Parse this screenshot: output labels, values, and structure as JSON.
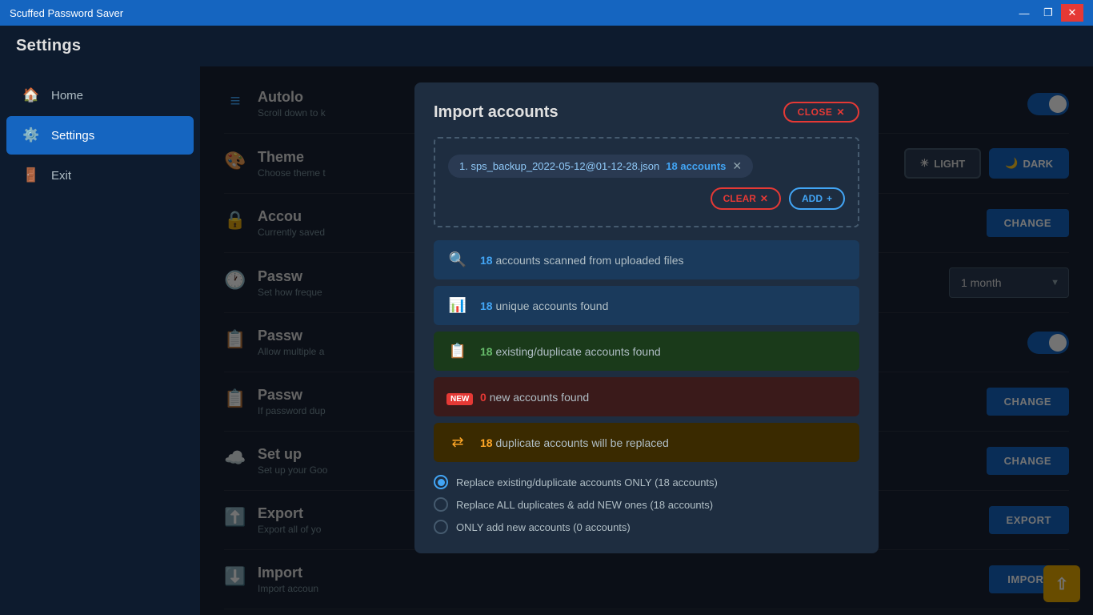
{
  "titlebar": {
    "title": "Scuffed Password Saver",
    "minimize": "—",
    "maximize": "❐",
    "close": "✕"
  },
  "app": {
    "header": "Settings"
  },
  "sidebar": {
    "items": [
      {
        "id": "home",
        "label": "Home",
        "icon": "🏠"
      },
      {
        "id": "settings",
        "label": "Settings",
        "icon": "⚙️",
        "active": true
      },
      {
        "id": "exit",
        "label": "Exit",
        "icon": "🚪"
      }
    ]
  },
  "settings": {
    "rows": [
      {
        "id": "autolock",
        "icon": "≡",
        "title": "Autolo",
        "desc": "Scroll down to k",
        "control": "toggle-on"
      },
      {
        "id": "theme",
        "icon": "🎨",
        "title": "Theme",
        "desc": "Choose theme t",
        "control": "theme-buttons"
      },
      {
        "id": "account",
        "icon": "🔒",
        "title": "Accou",
        "desc": "Currently saved",
        "control": "change"
      },
      {
        "id": "password-freq",
        "icon": "🕐",
        "title": "Passw",
        "desc": "Set how freque",
        "control": "dropdown"
      },
      {
        "id": "password-multi",
        "icon": "📋",
        "title": "Passw",
        "desc": "Allow multiple a",
        "control": "toggle-on"
      },
      {
        "id": "password-dup",
        "icon": "📋",
        "title": "Passw",
        "desc": "If password dup",
        "control": "change"
      },
      {
        "id": "setup",
        "icon": "☁️",
        "title": "Set up",
        "desc": "Set up your Goo",
        "control": "change"
      },
      {
        "id": "export",
        "icon": "⬆️",
        "title": "Export",
        "desc": "Export all of yo",
        "control": "export"
      },
      {
        "id": "import",
        "icon": "⬇️",
        "title": "Import",
        "desc": "Import accoun",
        "control": "import"
      }
    ],
    "theme_light": "LIGHT",
    "theme_dark": "DARK",
    "change_label": "CHANGE",
    "export_label": "EXPORT",
    "import_label": "IMPORT",
    "dropdown_value": "1 month"
  },
  "modal": {
    "title": "Import accounts",
    "close_label": "CLOSE",
    "file": {
      "name": "1. sps_backup_2022-05-12@01-12-28.json",
      "count_label": "18 accounts"
    },
    "clear_label": "CLEAR",
    "add_label": "ADD",
    "scan_rows": [
      {
        "id": "scanned",
        "color": "blue",
        "icon": "🔍",
        "count": "18",
        "text": " accounts scanned from uploaded files"
      },
      {
        "id": "unique",
        "color": "blue",
        "icon": "📊",
        "count": "18",
        "text": " unique accounts found"
      },
      {
        "id": "existing",
        "color": "green",
        "icon": "📋",
        "count": "18",
        "text": " existing/duplicate accounts found"
      },
      {
        "id": "new",
        "color": "red",
        "icon": "NEW",
        "count": "0",
        "text": " new accounts found",
        "badge": true
      },
      {
        "id": "duplicate",
        "color": "orange",
        "icon": "⇄",
        "count": "18",
        "text": " duplicate accounts will be replaced"
      }
    ],
    "radio_options": [
      {
        "id": "replace-existing",
        "label": "Replace existing/duplicate accounts ONLY (18 accounts)",
        "selected": true
      },
      {
        "id": "replace-all",
        "label": "Replace ALL duplicates & add NEW ones (18 accounts)",
        "selected": false
      },
      {
        "id": "add-new",
        "label": "ONLY add new accounts (0 accounts)",
        "selected": false
      }
    ]
  }
}
